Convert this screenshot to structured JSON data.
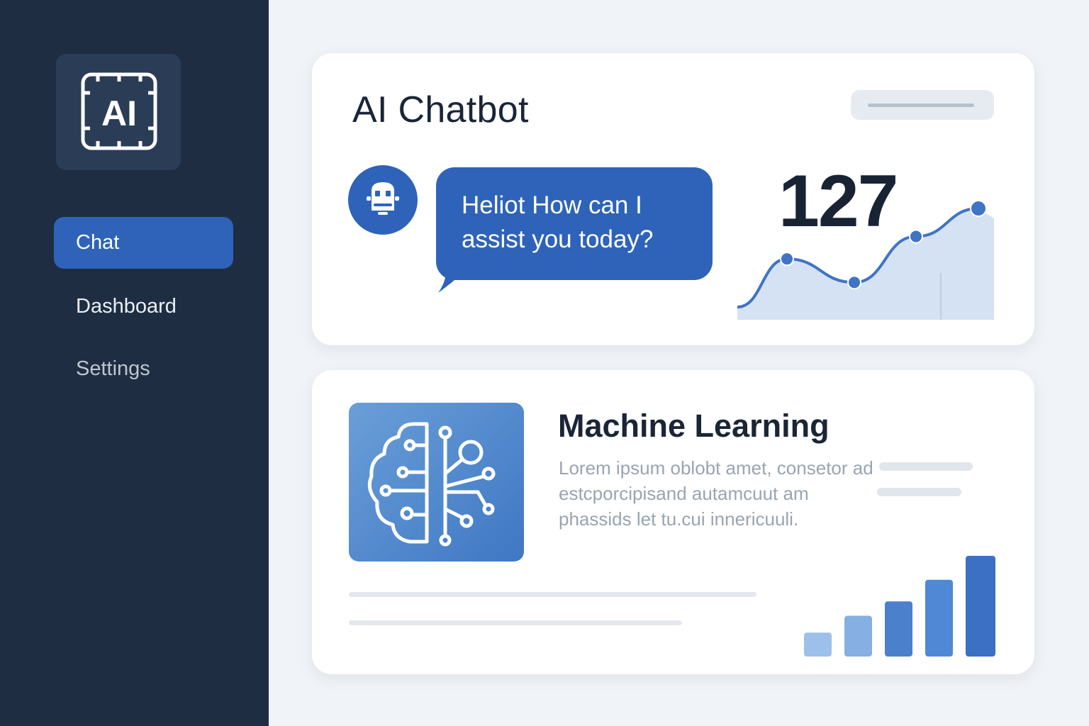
{
  "sidebar": {
    "logo_text": "AI",
    "items": [
      {
        "label": "Chat",
        "active": true
      },
      {
        "label": "Dashboard",
        "active": false
      },
      {
        "label": "Settings",
        "active": false
      }
    ]
  },
  "chat_card": {
    "title": "AI Chatbot",
    "message": "Heliot How can I assist you today?",
    "metric_value": "127",
    "sparkline": [
      0.05,
      0.48,
      0.27,
      0.68,
      0.93
    ]
  },
  "ml_card": {
    "title": "Machine Learning",
    "description": "Lorem ipsum oblobt amet, consetor ad estcporcipisand autamcuut am phassids let tu.cui innericuuli.",
    "bars": [
      1,
      1.7,
      2.3,
      3.2,
      4.2
    ]
  },
  "colors": {
    "accent": "#2e63b9",
    "sidebar": "#1f2d42",
    "background": "#f0f3f7"
  },
  "icons": {
    "logo": "ai-chip-icon",
    "bot": "robot-icon",
    "ml": "brain-circuit-icon"
  }
}
